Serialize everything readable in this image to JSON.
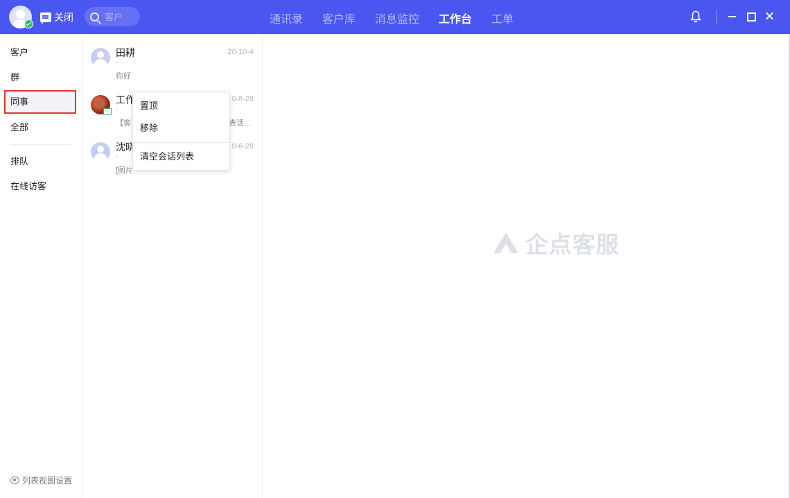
{
  "header": {
    "close_label": "关闭",
    "search": {
      "placeholder": "客户"
    },
    "tabs": [
      {
        "label": "通讯录",
        "active": false
      },
      {
        "label": "客户库",
        "active": false
      },
      {
        "label": "消息监控",
        "active": false
      },
      {
        "label": "工作台",
        "active": true
      },
      {
        "label": "工单",
        "active": false
      }
    ],
    "accent_color": "#4a56f0"
  },
  "sidebar": {
    "items": [
      {
        "label": "客户"
      },
      {
        "label": "群"
      },
      {
        "label": "同事",
        "selected": true
      },
      {
        "label": "全部"
      },
      {
        "label": "排队"
      },
      {
        "label": "在线访客"
      }
    ],
    "settings_label": "列表视图设置"
  },
  "conversations": [
    {
      "name": "田耕",
      "time": "20-10-4",
      "sub": "-",
      "message": "你好",
      "avatar": "default"
    },
    {
      "name": "工作",
      "time": "0-8-28",
      "sub": "-",
      "message": "【客",
      "message_right": "表话...",
      "avatar": "photo"
    },
    {
      "name": "沈晓",
      "time": "0-6-28",
      "sub": "-",
      "message": "[图片",
      "avatar": "default"
    }
  ],
  "context_menu": {
    "items": [
      "置顶",
      "移除",
      "清空会话列表"
    ]
  },
  "main": {
    "brand_text": "企点客服"
  }
}
